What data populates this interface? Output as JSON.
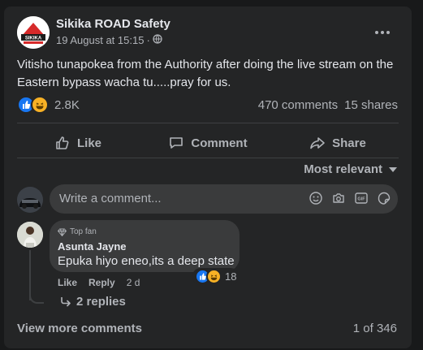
{
  "post": {
    "page_name": "Sikika ROAD Safety",
    "logo_text": "SIKIKA",
    "date": "19 August at 15:15",
    "separator": "·",
    "audience_icon": "globe-icon",
    "text": "Vitisho tunapokea from the Authority after doing the live stream on the Eastern bypass wacha tu.....pray for us.",
    "reactions": {
      "icons": [
        "like",
        "haha"
      ],
      "count": "2.8K"
    },
    "comments_count": "470 comments",
    "shares_count": "15 shares"
  },
  "actions": {
    "like": "Like",
    "comment": "Comment",
    "share": "Share"
  },
  "sort": {
    "label": "Most relevant"
  },
  "composer": {
    "placeholder": "Write a comment...",
    "icons": [
      "smiley-icon",
      "camera-icon",
      "gif-icon",
      "sticker-icon"
    ]
  },
  "comment": {
    "badge": "Top fan",
    "name": "Asunta Jayne",
    "text": "Epuka hiyo eneo,its a deep state",
    "reaction_count": "18",
    "like_label": "Like",
    "reply_label": "Reply",
    "time": "2 d",
    "replies_label": "2 replies"
  },
  "footer": {
    "view_more": "View more comments",
    "paging": "1 of 346"
  },
  "colors": {
    "background": "#18191a",
    "card": "#242526",
    "like_blue": "#1877f2",
    "haha_yellow": "#f7b125"
  }
}
